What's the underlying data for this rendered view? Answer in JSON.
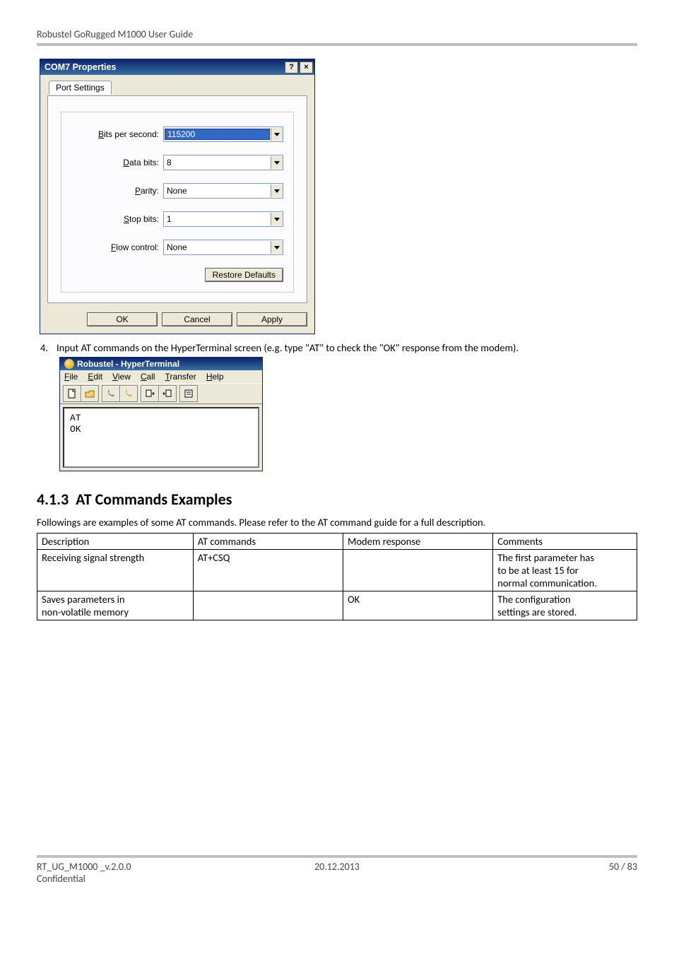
{
  "header": {
    "title": "Robustel GoRugged M1000 User Guide"
  },
  "dialog": {
    "title": "COM7 Properties",
    "tab": "Port Settings",
    "fields": {
      "bits_per_second": {
        "label_pre": "B",
        "label_rest": "its per second:",
        "value": "115200"
      },
      "data_bits": {
        "label_pre": "D",
        "label_rest": "ata bits:",
        "value": "8"
      },
      "parity": {
        "label_pre": "P",
        "label_rest": "arity:",
        "value": "None"
      },
      "stop_bits": {
        "label_pre": "S",
        "label_rest": "top bits:",
        "value": "1"
      },
      "flow_control": {
        "label_pre": "F",
        "label_rest": "low control:",
        "value": "None"
      }
    },
    "restore_pre": "R",
    "restore_rest": "estore Defaults",
    "ok": "OK",
    "cancel": "Cancel",
    "apply_pre": "A",
    "apply_rest": "pply"
  },
  "step4": {
    "num": "4.",
    "text": "Input AT commands on the HyperTerminal screen (e.g. type \"AT\" to check the \"OK\" response from the modem)."
  },
  "ht": {
    "title": "Robustel - HyperTerminal",
    "menu": [
      {
        "u": "F",
        "rest": "ile"
      },
      {
        "u": "E",
        "rest": "dit"
      },
      {
        "u": "V",
        "rest": "iew"
      },
      {
        "u": "C",
        "rest": "all"
      },
      {
        "u": "T",
        "rest": "ransfer"
      },
      {
        "u": "H",
        "rest": "elp"
      }
    ],
    "term_lines": [
      "AT",
      "OK"
    ]
  },
  "section": {
    "num": "4.1.3",
    "title": "AT Commands Examples"
  },
  "table_intro": "Followings are examples of some AT commands. Please refer to the AT command guide for a full description.",
  "at_table": {
    "headers": [
      "Description",
      "AT commands",
      "Modem response",
      "Comments"
    ],
    "rows": [
      {
        "description": "Receiving signal strength",
        "command": "AT+CSQ",
        "response": "",
        "comments_lines": [
          "The first parameter has",
          "to be at least 15 for",
          "normal communication."
        ]
      },
      {
        "description_lines": [
          "Saves parameters in",
          "non-volatile memory"
        ],
        "command": "",
        "response": "OK",
        "comments_lines": [
          "The configuration",
          "settings are stored."
        ]
      }
    ]
  },
  "footer": {
    "left": "RT_UG_M1000 _v.2.0.0",
    "conf": "Confidential",
    "center": "20.12.2013",
    "right": "50 / 83"
  }
}
